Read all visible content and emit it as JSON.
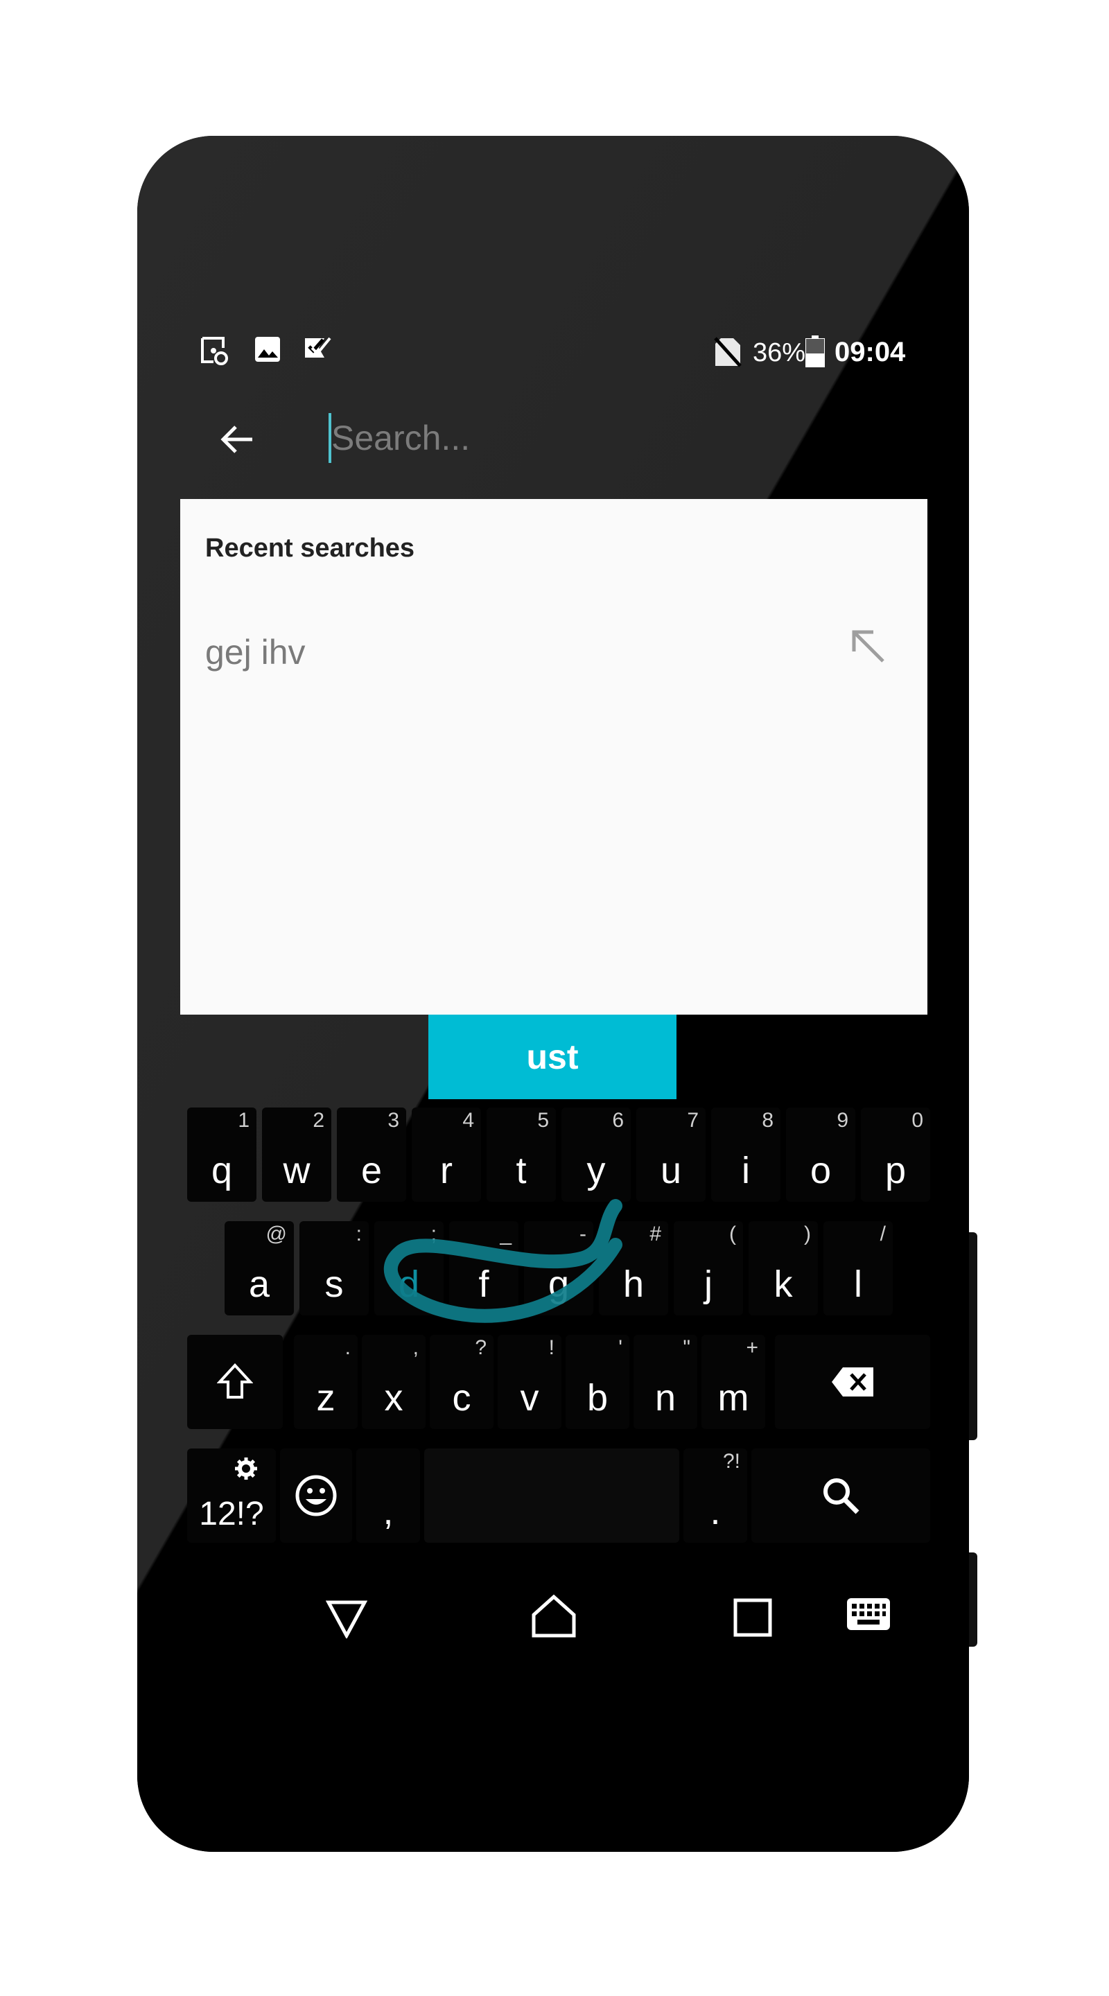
{
  "status_bar": {
    "battery_percent": "36%",
    "time": "09:04",
    "left_icons": [
      "screenshot-icon",
      "image-icon",
      "checklist-icon"
    ],
    "right_icons": [
      "no-sim-icon",
      "battery-icon"
    ]
  },
  "search": {
    "placeholder": "Search..."
  },
  "recent": {
    "title": "Recent searches",
    "items": [
      {
        "text": "gej ihv"
      }
    ]
  },
  "suggestion": "ust",
  "keyboard": {
    "row1": [
      {
        "key": "q",
        "hint": "1"
      },
      {
        "key": "w",
        "hint": "2"
      },
      {
        "key": "e",
        "hint": "3"
      },
      {
        "key": "r",
        "hint": "4"
      },
      {
        "key": "t",
        "hint": "5"
      },
      {
        "key": "y",
        "hint": "6"
      },
      {
        "key": "u",
        "hint": "7"
      },
      {
        "key": "i",
        "hint": "8"
      },
      {
        "key": "o",
        "hint": "9"
      },
      {
        "key": "p",
        "hint": "0"
      }
    ],
    "row2": [
      {
        "key": "a",
        "hint": "@"
      },
      {
        "key": "s",
        "hint": ":"
      },
      {
        "key": "d",
        "hint": ";"
      },
      {
        "key": "f",
        "hint": "_"
      },
      {
        "key": "g",
        "hint": "-"
      },
      {
        "key": "h",
        "hint": "#"
      },
      {
        "key": "j",
        "hint": "("
      },
      {
        "key": "k",
        "hint": ")"
      },
      {
        "key": "l",
        "hint": "/"
      }
    ],
    "row3": [
      {
        "key": "z",
        "hint": "."
      },
      {
        "key": "x",
        "hint": ","
      },
      {
        "key": "c",
        "hint": "?"
      },
      {
        "key": "v",
        "hint": "!"
      },
      {
        "key": "b",
        "hint": "'"
      },
      {
        "key": "n",
        "hint": "\""
      },
      {
        "key": "m",
        "hint": "+"
      }
    ],
    "symbols_label": "12!?",
    "comma": ",",
    "period": ".",
    "period_hint": "?!",
    "accent_color": "#00bcd4",
    "gesture_color": "#0e7d8a"
  },
  "nav_bar": {
    "buttons": [
      "back-triangle-icon",
      "home-icon",
      "recents-icon",
      "keyboard-icon"
    ]
  }
}
